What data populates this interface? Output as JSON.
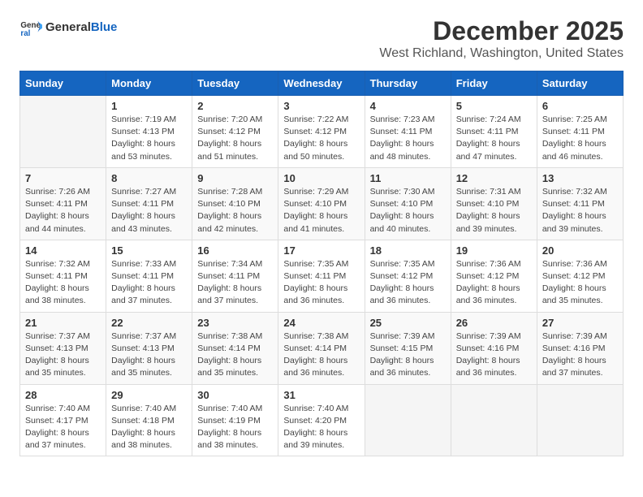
{
  "header": {
    "logo_general": "General",
    "logo_blue": "Blue",
    "month": "December 2025",
    "location": "West Richland, Washington, United States"
  },
  "calendar": {
    "days_of_week": [
      "Sunday",
      "Monday",
      "Tuesday",
      "Wednesday",
      "Thursday",
      "Friday",
      "Saturday"
    ],
    "weeks": [
      [
        {
          "day": "",
          "info": ""
        },
        {
          "day": "1",
          "info": "Sunrise: 7:19 AM\nSunset: 4:13 PM\nDaylight: 8 hours\nand 53 minutes."
        },
        {
          "day": "2",
          "info": "Sunrise: 7:20 AM\nSunset: 4:12 PM\nDaylight: 8 hours\nand 51 minutes."
        },
        {
          "day": "3",
          "info": "Sunrise: 7:22 AM\nSunset: 4:12 PM\nDaylight: 8 hours\nand 50 minutes."
        },
        {
          "day": "4",
          "info": "Sunrise: 7:23 AM\nSunset: 4:11 PM\nDaylight: 8 hours\nand 48 minutes."
        },
        {
          "day": "5",
          "info": "Sunrise: 7:24 AM\nSunset: 4:11 PM\nDaylight: 8 hours\nand 47 minutes."
        },
        {
          "day": "6",
          "info": "Sunrise: 7:25 AM\nSunset: 4:11 PM\nDaylight: 8 hours\nand 46 minutes."
        }
      ],
      [
        {
          "day": "7",
          "info": "Sunrise: 7:26 AM\nSunset: 4:11 PM\nDaylight: 8 hours\nand 44 minutes."
        },
        {
          "day": "8",
          "info": "Sunrise: 7:27 AM\nSunset: 4:11 PM\nDaylight: 8 hours\nand 43 minutes."
        },
        {
          "day": "9",
          "info": "Sunrise: 7:28 AM\nSunset: 4:10 PM\nDaylight: 8 hours\nand 42 minutes."
        },
        {
          "day": "10",
          "info": "Sunrise: 7:29 AM\nSunset: 4:10 PM\nDaylight: 8 hours\nand 41 minutes."
        },
        {
          "day": "11",
          "info": "Sunrise: 7:30 AM\nSunset: 4:10 PM\nDaylight: 8 hours\nand 40 minutes."
        },
        {
          "day": "12",
          "info": "Sunrise: 7:31 AM\nSunset: 4:10 PM\nDaylight: 8 hours\nand 39 minutes."
        },
        {
          "day": "13",
          "info": "Sunrise: 7:32 AM\nSunset: 4:11 PM\nDaylight: 8 hours\nand 39 minutes."
        }
      ],
      [
        {
          "day": "14",
          "info": "Sunrise: 7:32 AM\nSunset: 4:11 PM\nDaylight: 8 hours\nand 38 minutes."
        },
        {
          "day": "15",
          "info": "Sunrise: 7:33 AM\nSunset: 4:11 PM\nDaylight: 8 hours\nand 37 minutes."
        },
        {
          "day": "16",
          "info": "Sunrise: 7:34 AM\nSunset: 4:11 PM\nDaylight: 8 hours\nand 37 minutes."
        },
        {
          "day": "17",
          "info": "Sunrise: 7:35 AM\nSunset: 4:11 PM\nDaylight: 8 hours\nand 36 minutes."
        },
        {
          "day": "18",
          "info": "Sunrise: 7:35 AM\nSunset: 4:12 PM\nDaylight: 8 hours\nand 36 minutes."
        },
        {
          "day": "19",
          "info": "Sunrise: 7:36 AM\nSunset: 4:12 PM\nDaylight: 8 hours\nand 36 minutes."
        },
        {
          "day": "20",
          "info": "Sunrise: 7:36 AM\nSunset: 4:12 PM\nDaylight: 8 hours\nand 35 minutes."
        }
      ],
      [
        {
          "day": "21",
          "info": "Sunrise: 7:37 AM\nSunset: 4:13 PM\nDaylight: 8 hours\nand 35 minutes."
        },
        {
          "day": "22",
          "info": "Sunrise: 7:37 AM\nSunset: 4:13 PM\nDaylight: 8 hours\nand 35 minutes."
        },
        {
          "day": "23",
          "info": "Sunrise: 7:38 AM\nSunset: 4:14 PM\nDaylight: 8 hours\nand 35 minutes."
        },
        {
          "day": "24",
          "info": "Sunrise: 7:38 AM\nSunset: 4:14 PM\nDaylight: 8 hours\nand 36 minutes."
        },
        {
          "day": "25",
          "info": "Sunrise: 7:39 AM\nSunset: 4:15 PM\nDaylight: 8 hours\nand 36 minutes."
        },
        {
          "day": "26",
          "info": "Sunrise: 7:39 AM\nSunset: 4:16 PM\nDaylight: 8 hours\nand 36 minutes."
        },
        {
          "day": "27",
          "info": "Sunrise: 7:39 AM\nSunset: 4:16 PM\nDaylight: 8 hours\nand 37 minutes."
        }
      ],
      [
        {
          "day": "28",
          "info": "Sunrise: 7:40 AM\nSunset: 4:17 PM\nDaylight: 8 hours\nand 37 minutes."
        },
        {
          "day": "29",
          "info": "Sunrise: 7:40 AM\nSunset: 4:18 PM\nDaylight: 8 hours\nand 38 minutes."
        },
        {
          "day": "30",
          "info": "Sunrise: 7:40 AM\nSunset: 4:19 PM\nDaylight: 8 hours\nand 38 minutes."
        },
        {
          "day": "31",
          "info": "Sunrise: 7:40 AM\nSunset: 4:20 PM\nDaylight: 8 hours\nand 39 minutes."
        },
        {
          "day": "",
          "info": ""
        },
        {
          "day": "",
          "info": ""
        },
        {
          "day": "",
          "info": ""
        }
      ]
    ]
  }
}
